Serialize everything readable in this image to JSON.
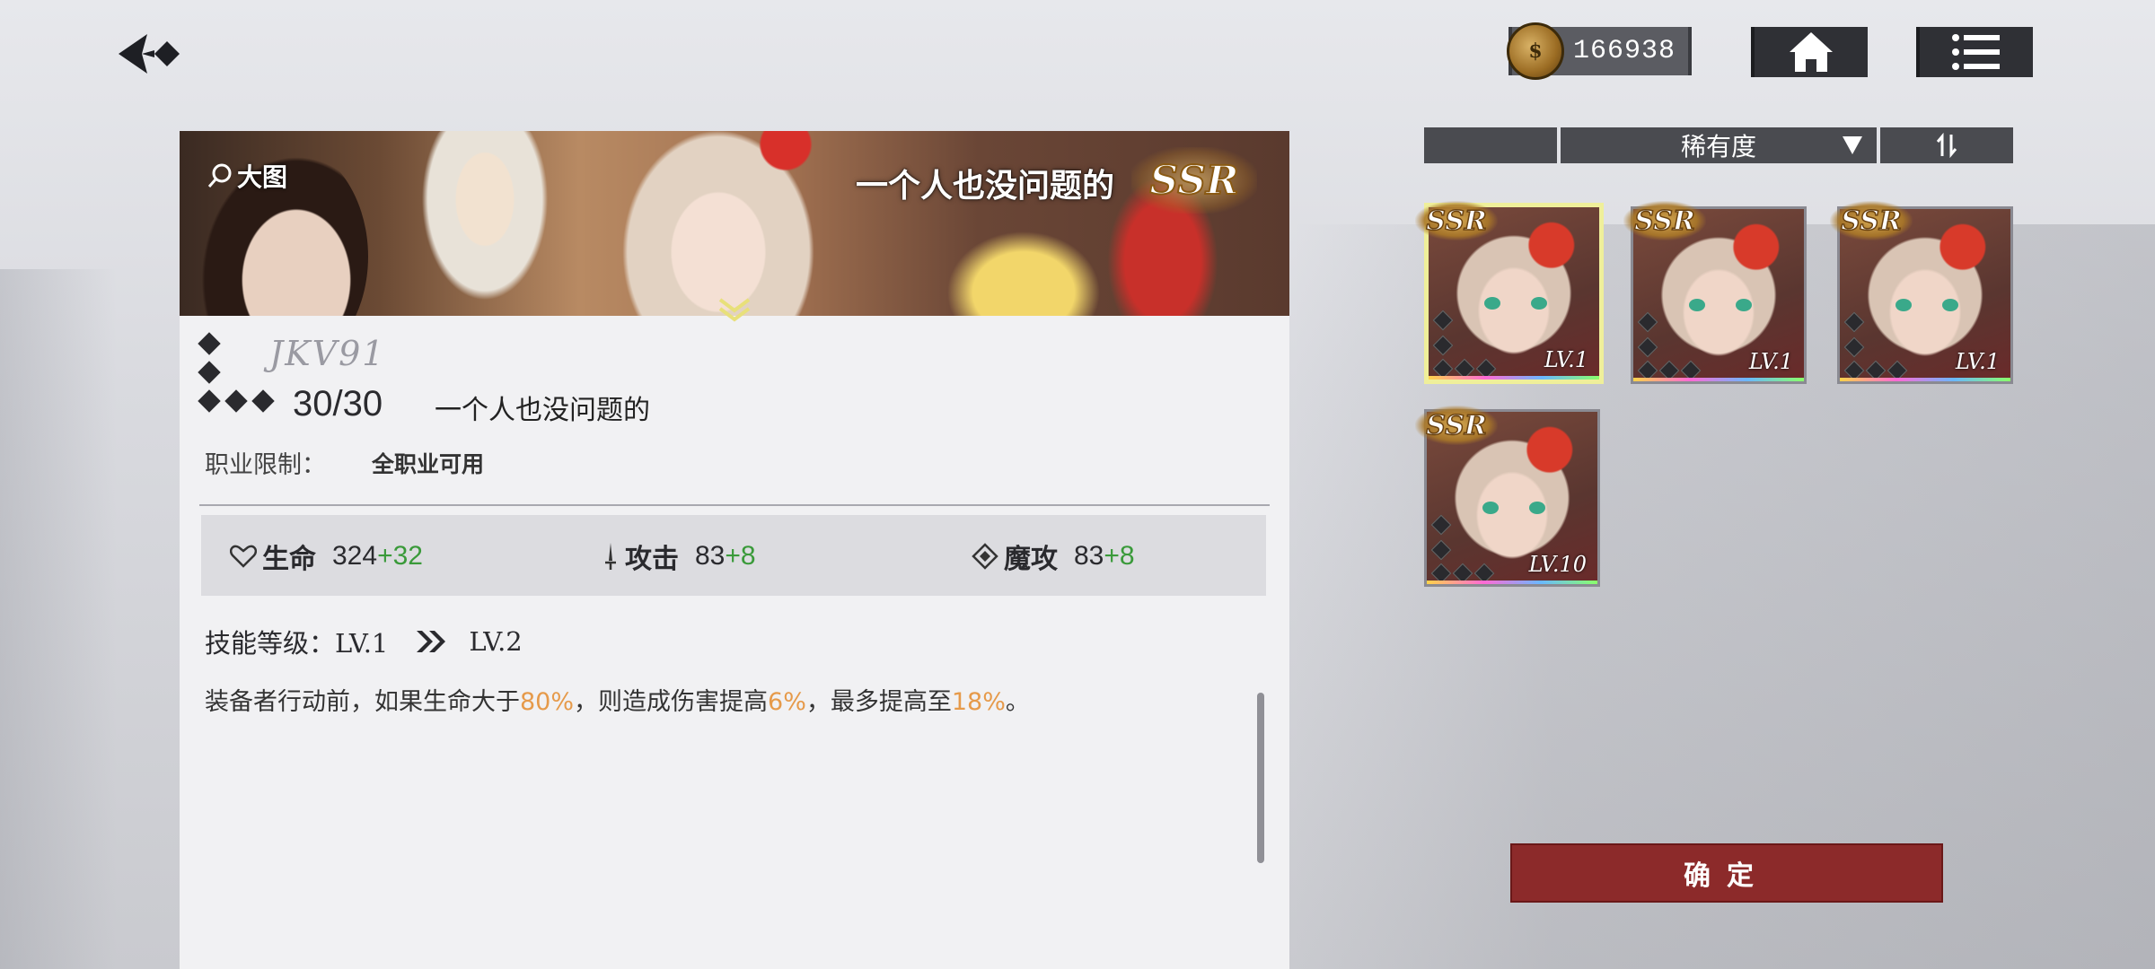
{
  "top_bar": {
    "currency_value": "166938",
    "currency_icon": "coin-icon",
    "home_icon": "home-icon",
    "menu_icon": "menu-list-icon"
  },
  "detail": {
    "banner_title": "一个人也没问题的",
    "rarity": "SSR",
    "zoom_label": "大图",
    "signature": "JKV91",
    "level": "30/30",
    "name": "一个人也没问题的",
    "restriction_label": "职业限制：",
    "restriction_value": "全职业可用",
    "stats": [
      {
        "icon": "heart-icon",
        "label": "生命",
        "value": "324",
        "bonus": "+32"
      },
      {
        "icon": "sword-icon",
        "label": "攻击",
        "value": "83",
        "bonus": "+8"
      },
      {
        "icon": "magic-icon",
        "label": "魔攻",
        "value": "83",
        "bonus": "+8"
      }
    ],
    "skill_label": "技能等级：LV.1",
    "skill_next": "LV.2",
    "desc_parts": [
      "装备者行动前，如果生命大于",
      "80%",
      "，则造成伤害提高",
      "6%",
      "，最多提高至",
      "18%",
      "。"
    ]
  },
  "filter": {
    "sort_label": "稀有度",
    "dropdown_icon": "triangle-down-icon",
    "order_icon": "sort-order-icon"
  },
  "cards": [
    {
      "rarity": "SSR",
      "level": "LV.1",
      "selected": true
    },
    {
      "rarity": "SSR",
      "level": "LV.1",
      "selected": false
    },
    {
      "rarity": "SSR",
      "level": "LV.1",
      "selected": false
    },
    {
      "rarity": "SSR",
      "level": "LV.10",
      "selected": false
    }
  ],
  "confirm_label": "确定",
  "colors": {
    "confirm_bg": "#8c2a2a",
    "bonus_green": "#3a9a3a",
    "highlight_orange": "#e69a4a",
    "selected_border": "#efef9a"
  }
}
